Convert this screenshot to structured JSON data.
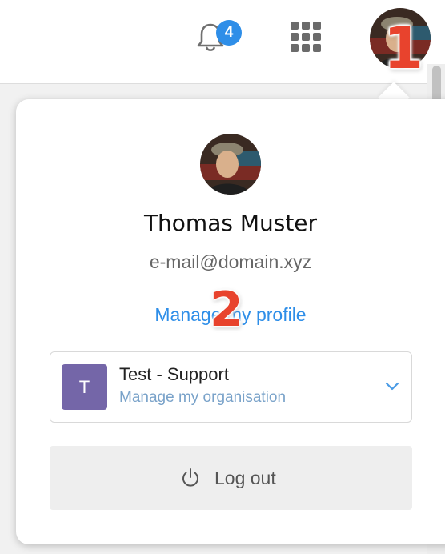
{
  "header": {
    "notifications_count": "4",
    "icons": [
      "bell-icon",
      "apps-grid-icon",
      "user-avatar"
    ]
  },
  "annotations": {
    "step1": "1",
    "step2": "2"
  },
  "profile": {
    "name": "Thomas Muster",
    "email": "e-mail@domain.xyz",
    "manage_label": "Manage my profile"
  },
  "organisation": {
    "initial": "T",
    "name": "Test - Support",
    "manage_label": "Manage my organisation",
    "tile_color": "#7466a8",
    "icon": "chevron-down-icon"
  },
  "logout": {
    "label": "Log out",
    "icon": "power-icon"
  },
  "colors": {
    "accent": "#2e8ee8",
    "badge": "#2e8ee8",
    "annotation": "#e8432d",
    "org_link": "#79a2c9"
  }
}
